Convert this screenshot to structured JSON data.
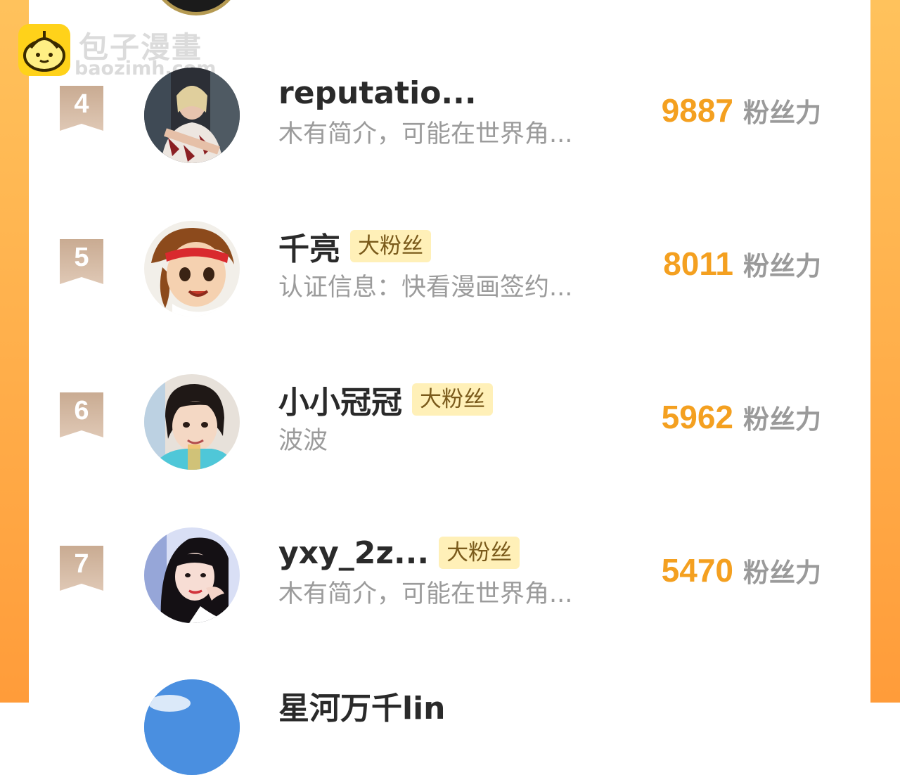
{
  "watermark": {
    "name": "包子漫畫",
    "domain": "baozimh.com"
  },
  "colors": {
    "frame": "#ffb347",
    "score": "#f4a020",
    "fan_tag_bg": "#fff0b8",
    "rank_badge": "#c9a98c"
  },
  "leaderboard": [
    {
      "rank": "4",
      "name": "reputatio...",
      "bio": "木有简介，可能在世界角...",
      "score": "9887",
      "unit": "粉丝力",
      "badge": ""
    },
    {
      "rank": "5",
      "name": "千亮",
      "bio": "认证信息：快看漫画签约...",
      "score": "8011",
      "unit": "粉丝力",
      "badge": "大粉丝"
    },
    {
      "rank": "6",
      "name": "小小冠冠",
      "bio": "波波",
      "score": "5962",
      "unit": "粉丝力",
      "badge": "大粉丝"
    },
    {
      "rank": "7",
      "name": "yxy_2z...",
      "bio": "木有简介，可能在世界角...",
      "score": "5470",
      "unit": "粉丝力",
      "badge": "大粉丝"
    }
  ],
  "next_entry": {
    "name": "星河万千lin"
  }
}
